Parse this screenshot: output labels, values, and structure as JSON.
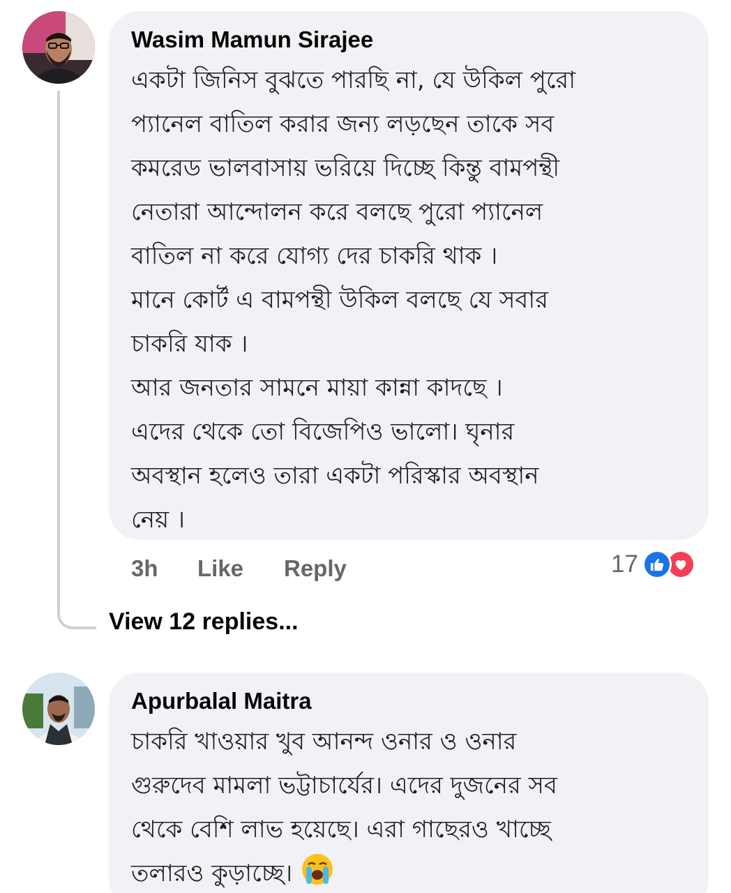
{
  "comments": [
    {
      "author": "Wasim Mamun Sirajee",
      "lines": [
        "একটা জিনিস বুঝতে পারছি না, যে উকিল পুরো",
        "প্যানেল বাতিল করার জন্য লড়ছেন তাকে সব",
        "কমরেড ভালবাসায় ভরিয়ে দিচ্ছে কিন্তু বামপন্থী",
        "নেতারা আন্দোলন করে বলছে পুরো প্যানেল",
        "বাতিল না করে যোগ্য দের চাকরি থাক ।",
        "মানে কোর্ট এ বামপন্থী উকিল বলছে যে সবার",
        "চাকরি যাক ।",
        "আর জনতার সামনে মায়া কান্না কাদছে ।",
        "এদের থেকে তো বিজেপিও ভালো। ঘৃনার",
        "অবস্থান হলেও তারা   একটা পরিস্কার অবস্থান",
        "নেয় ।"
      ],
      "time": "3h",
      "like_label": "Like",
      "reply_label": "Reply",
      "reaction_count": "17",
      "reactions": [
        "like-icon",
        "love-icon"
      ],
      "view_replies": "View 12 replies..."
    },
    {
      "author": "Apurbalal Maitra",
      "lines": [
        "চাকরি খাওয়ার খুব আনন্দ ওনার ও ওনার",
        "গুরুদেব মামলা ভট্টাচার্যের। এদের দুজনের সব",
        "থেকে বেশি লাভ হয়েছে। এরা গাছেরও খাচ্ছে",
        "তলারও কুড়াচ্ছে।"
      ],
      "trailing_emoji": "loudly-crying-face-emoji"
    }
  ],
  "colors": {
    "bubble": "#f0f2f5",
    "meta_text": "#65676b",
    "like_blue": "#1b74e4",
    "love_red": "#f33e58"
  }
}
